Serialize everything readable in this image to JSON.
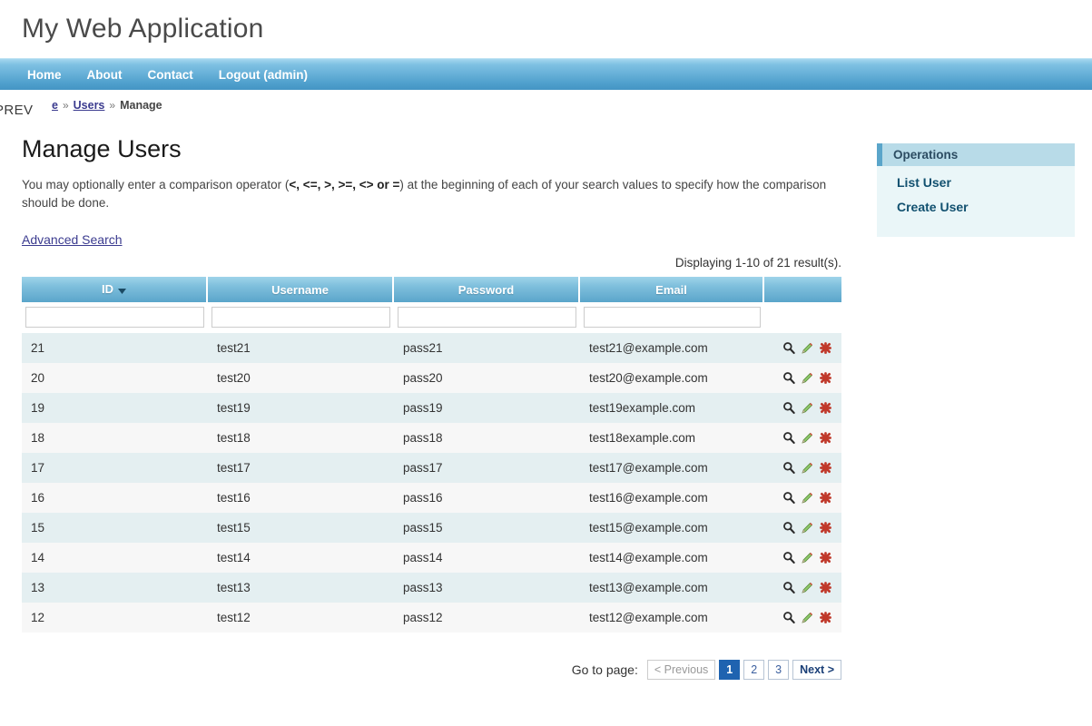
{
  "header": {
    "app_title": "My Web Application"
  },
  "nav": {
    "items": [
      {
        "label": "Home",
        "name": "nav-item-home"
      },
      {
        "label": "About",
        "name": "nav-item-about"
      },
      {
        "label": "Contact",
        "name": "nav-item-contact"
      },
      {
        "label": "Logout (admin)",
        "name": "nav-item-logout"
      }
    ]
  },
  "overlay": {
    "prev_marker": "PREV"
  },
  "breadcrumb": {
    "first_link": "e",
    "separator": "»",
    "second_link": "Users",
    "current": "Manage"
  },
  "main": {
    "page_title": "Manage Users",
    "description_pre": "You may optionally enter a comparison operator (",
    "description_ops": "<, <=, >, >=, <> or =",
    "description_post": ") at the beginning of each of your search values to specify how the comparison should be done.",
    "advanced_search_label": "Advanced Search",
    "summary": "Displaying 1-10 of 21 result(s)."
  },
  "grid": {
    "columns": [
      {
        "label": "ID",
        "sorted": true,
        "sort_dir": "desc",
        "name": "column-header-id"
      },
      {
        "label": "Username",
        "sorted": false,
        "name": "column-header-username"
      },
      {
        "label": "Password",
        "sorted": false,
        "name": "column-header-password"
      },
      {
        "label": "Email",
        "sorted": false,
        "name": "column-header-email"
      },
      {
        "label": "",
        "sorted": false,
        "name": "column-header-actions"
      }
    ],
    "filters": {
      "id": "",
      "username": "",
      "password": "",
      "email": ""
    },
    "filter_placeholder": "",
    "row_actions": [
      {
        "label": "View",
        "name": "view-icon"
      },
      {
        "label": "Update",
        "name": "update-icon"
      },
      {
        "label": "Delete",
        "name": "delete-icon"
      }
    ],
    "rows": [
      {
        "id": "21",
        "username": "test21",
        "password": "pass21",
        "email": "test21@example.com"
      },
      {
        "id": "20",
        "username": "test20",
        "password": "pass20",
        "email": "test20@example.com"
      },
      {
        "id": "19",
        "username": "test19",
        "password": "pass19",
        "email": "test19example.com"
      },
      {
        "id": "18",
        "username": "test18",
        "password": "pass18",
        "email": "test18example.com"
      },
      {
        "id": "17",
        "username": "test17",
        "password": "pass17",
        "email": "test17@example.com"
      },
      {
        "id": "16",
        "username": "test16",
        "password": "pass16",
        "email": "test16@example.com"
      },
      {
        "id": "15",
        "username": "test15",
        "password": "pass15",
        "email": "test15@example.com"
      },
      {
        "id": "14",
        "username": "test14",
        "password": "pass14",
        "email": "test14@example.com"
      },
      {
        "id": "13",
        "username": "test13",
        "password": "pass13",
        "email": "test13@example.com"
      },
      {
        "id": "12",
        "username": "test12",
        "password": "pass12",
        "email": "test12@example.com"
      }
    ]
  },
  "sidebar": {
    "portlet_title": "Operations",
    "items": [
      {
        "label": "List User",
        "name": "sidebar-item-list-user"
      },
      {
        "label": "Create User",
        "name": "sidebar-item-create-user"
      }
    ]
  },
  "pager": {
    "label": "Go to page:",
    "previous": "< Previous",
    "pages": [
      "1",
      "2",
      "3"
    ],
    "active_page": "1",
    "next": "Next >"
  },
  "colors": {
    "nav_blue": "#4e9fcc",
    "header_blue": "#5aa5ca",
    "row_odd": "#e4eff1",
    "row_even": "#f7f7f7",
    "link_blue": "#3b3b8f",
    "active_page_blue": "#1f63b0",
    "portlet_head": "#b8dbe8",
    "portlet_body": "#eaf6f8"
  }
}
